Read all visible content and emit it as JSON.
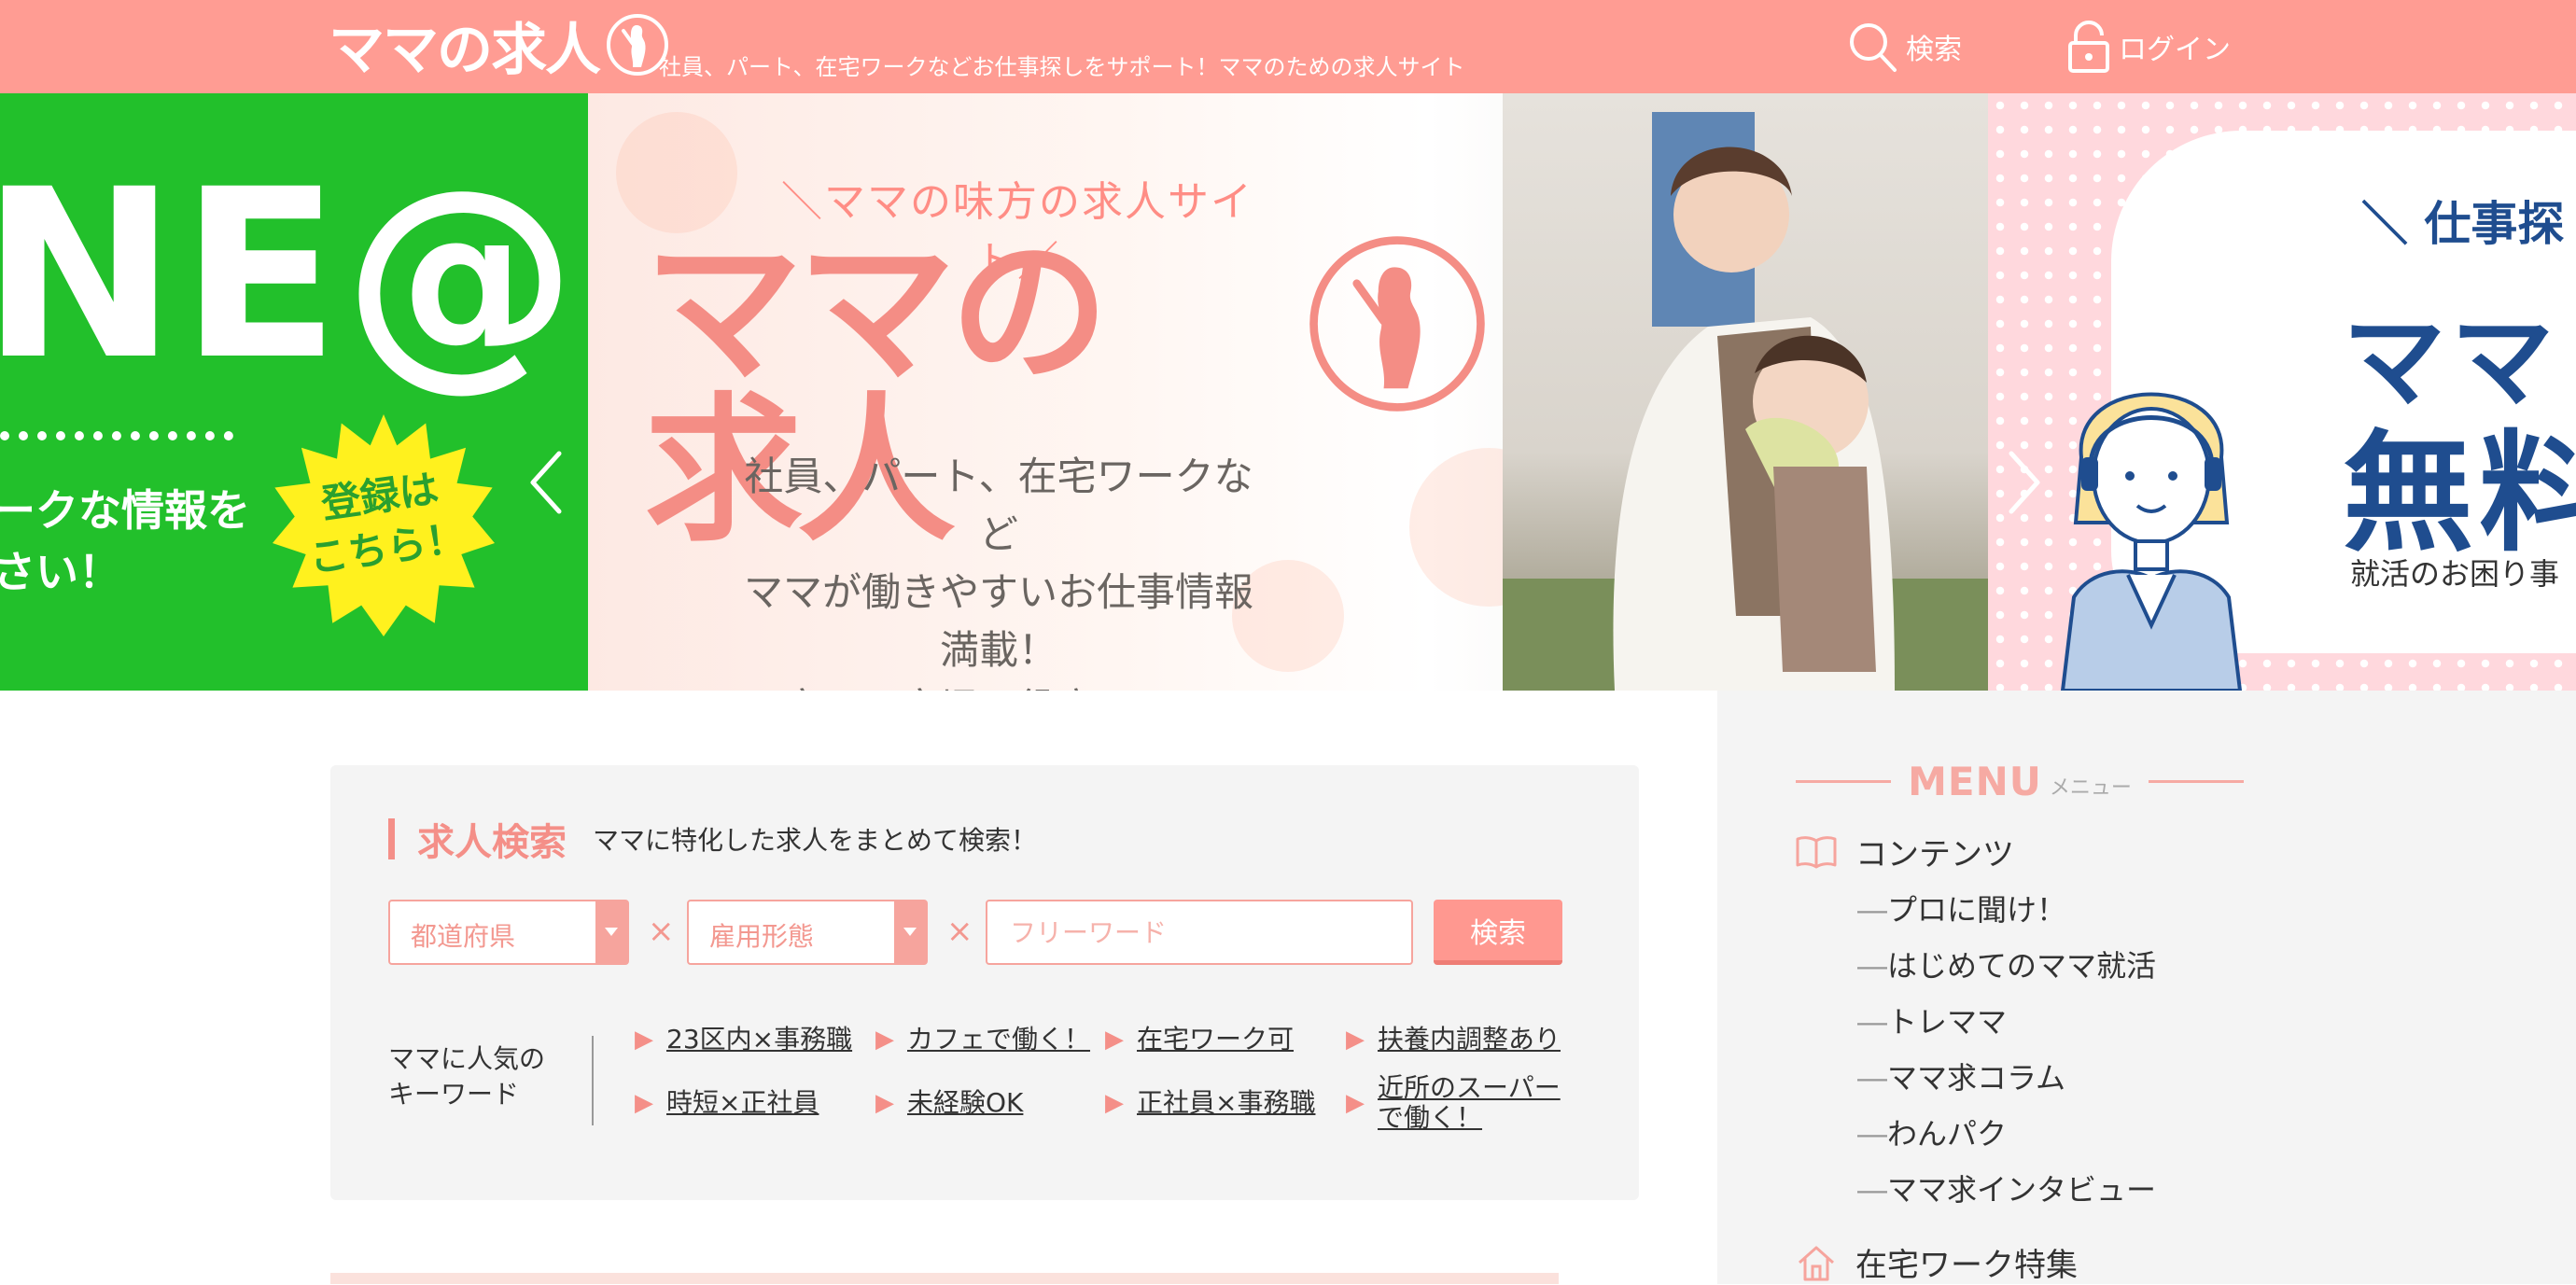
{
  "header": {
    "logo_text": "ママの求人",
    "tagline": "社員、パート、在宅ワークなどお仕事探しをサポート！ママのための求人サイト",
    "search_label": "検索",
    "login_label": "ログイン"
  },
  "hero": {
    "left_slide": {
      "big_text": "NE@",
      "text_line1": "ークな情報を",
      "text_line2": "さい！",
      "burst_line1": "登録は",
      "burst_line2": "こちら！"
    },
    "center_slide": {
      "subtitle": "＼ママの味方の求人サイト／",
      "title": "ママの求人",
      "line1": "社員、パート、在宅ワークなど",
      "line2": "ママが働きやすいお仕事情報 満載！",
      "line3": "子育て・育児に役立つコンテンツも！"
    },
    "right_slide": {
      "head": "＼ 仕事探",
      "big1": "ママ",
      "big2": "無料",
      "small": "就活のお困り事"
    }
  },
  "search": {
    "title": "求人検索",
    "description": "ママに特化した求人をまとめて検索！",
    "prefecture_label": "都道府県",
    "employment_label": "雇用形態",
    "times1": "×",
    "times2": "×",
    "freeword_placeholder": "フリーワード",
    "button_label": "検索",
    "keywords_label_line1": "ママに人気の",
    "keywords_label_line2": "キーワード",
    "keywords": [
      {
        "text": "23区内×事務職"
      },
      {
        "text": "カフェで働く！"
      },
      {
        "text": "在宅ワーク可"
      },
      {
        "text": "扶養内調整あり"
      },
      {
        "text": "時短×正社員"
      },
      {
        "text": "未経験OK"
      },
      {
        "text": "正社員×事務職"
      },
      {
        "text_line1": "近所のスーパー",
        "text_line2": "で働く！"
      }
    ]
  },
  "sidebar": {
    "menu_title": "MENU",
    "menu_sub": "メニュー",
    "categories": [
      {
        "label": "コンテンツ",
        "icon": "book-icon"
      },
      {
        "label": "在宅ワーク特集",
        "icon": "home-icon"
      }
    ],
    "content_items": [
      {
        "label": "プロに聞け！"
      },
      {
        "label": "はじめてのママ就活"
      },
      {
        "label": "トレママ"
      },
      {
        "label": "ママ求コラム"
      },
      {
        "label": "わんパク"
      },
      {
        "label": "ママ求インタビュー"
      }
    ],
    "item_dash": "―"
  },
  "colors": {
    "brand": "#ff9c93",
    "accent": "#f48f88",
    "line_green": "#22c02b",
    "navy": "#1f4d8f"
  }
}
